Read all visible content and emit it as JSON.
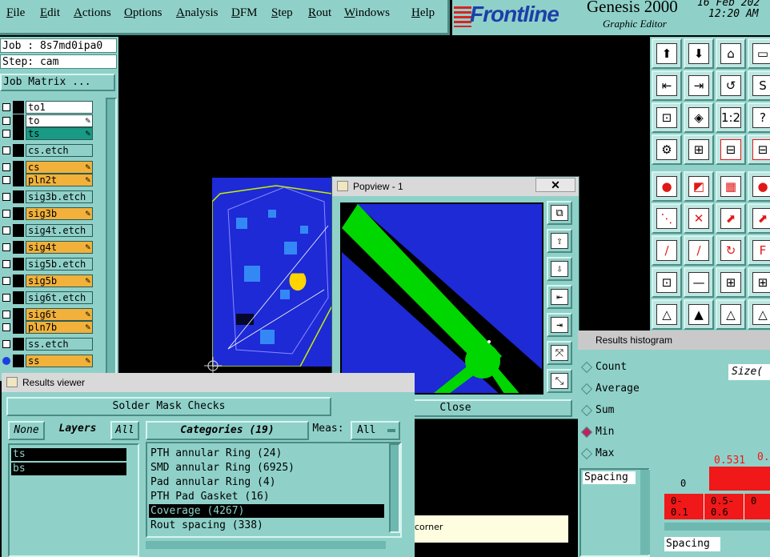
{
  "menu": {
    "items": [
      {
        "label": "File",
        "u": "F",
        "rest": "ile"
      },
      {
        "label": "Edit",
        "u": "E",
        "rest": "dit"
      },
      {
        "label": "Actions",
        "u": "A",
        "rest": "ctions"
      },
      {
        "label": "Options",
        "u": "O",
        "rest": "ptions"
      },
      {
        "label": "Analysis",
        "u": "A",
        "rest": "nalysis"
      },
      {
        "label": "DFM",
        "u": "D",
        "rest": "FM"
      },
      {
        "label": "Step",
        "u": "S",
        "rest": "tep"
      },
      {
        "label": "Rout",
        "u": "R",
        "rest": "out"
      },
      {
        "label": "Windows",
        "u": "W",
        "rest": "indows"
      },
      {
        "label": "Help",
        "u": "H",
        "rest": "elp"
      }
    ]
  },
  "brand": {
    "logo": "Frontline",
    "product": "Genesis 2000",
    "subtitle": "Graphic Editor",
    "date": "16 Feb 202",
    "time": "12:20 AM"
  },
  "job": {
    "job_line": "Job : 8s7md0ipa0",
    "step_line": "Step: cam",
    "matrix_button": "Job Matrix ..."
  },
  "layers": [
    {
      "name": "to1",
      "bg": "#ffffff",
      "pen": false
    },
    {
      "name": "to",
      "bg": "#ffffff",
      "pen": true
    },
    {
      "name": "ts",
      "bg": "#199a85",
      "pen": true
    },
    {
      "name": "cs.etch",
      "bg": "#8fd1c9",
      "pen": false
    },
    {
      "name": "cs",
      "bg": "#f2b13a",
      "pen": true
    },
    {
      "name": "pln2t",
      "bg": "#f2b13a",
      "pen": true
    },
    {
      "name": "sig3b.etch",
      "bg": "#8fd1c9",
      "pen": false
    },
    {
      "name": "sig3b",
      "bg": "#f2b13a",
      "pen": true
    },
    {
      "name": "sig4t.etch",
      "bg": "#8fd1c9",
      "pen": false
    },
    {
      "name": "sig4t",
      "bg": "#f2b13a",
      "pen": true
    },
    {
      "name": "sig5b.etch",
      "bg": "#8fd1c9",
      "pen": false
    },
    {
      "name": "sig5b",
      "bg": "#f2b13a",
      "pen": true
    },
    {
      "name": "sig6t.etch",
      "bg": "#8fd1c9",
      "pen": false
    },
    {
      "name": "sig6t",
      "bg": "#f2b13a",
      "pen": true
    },
    {
      "name": "pln7b",
      "bg": "#f2b13a",
      "pen": true
    },
    {
      "name": "ss.etch",
      "bg": "#8fd1c9",
      "pen": false
    },
    {
      "name": "ss",
      "bg": "#f2b13a",
      "pen": true
    }
  ],
  "popview": {
    "title": "Popview - 1",
    "close_x": "✕",
    "close_button": "Close"
  },
  "histogram": {
    "title": "Results histogram",
    "options": [
      {
        "label": "Count",
        "on": false
      },
      {
        "label": "Average",
        "on": false
      },
      {
        "label": "Sum",
        "on": false
      },
      {
        "label": "Min",
        "on": true
      },
      {
        "label": "Max",
        "on": false
      }
    ],
    "list_item": "Spacing",
    "list_item_2": "Spacing",
    "size_label": "Size(",
    "bar_value_1": "0.531",
    "bar_value_2": "0.",
    "axis_zero": "0",
    "bins": [
      "0-\n0.1",
      "0.5-\n0.6",
      "0"
    ]
  },
  "results_viewer": {
    "title": "Results viewer",
    "check_name": "Solder Mask Checks",
    "none_btn": "None",
    "layers_label": "Layers",
    "all_btn": "All",
    "categories_label": "Categories (19)",
    "meas_label": "Meas:",
    "meas_value": "All",
    "layers": [
      "ts",
      "bs"
    ],
    "categories": [
      {
        "label": "PTH annular Ring (24)",
        "sel": false
      },
      {
        "label": "SMD annular Ring (6925)",
        "sel": false
      },
      {
        "label": "Pad annular Ring (4)",
        "sel": false
      },
      {
        "label": "PTH Pad Gasket (16)",
        "sel": false
      },
      {
        "label": "Coverage (4267)",
        "sel": true
      },
      {
        "label": "Rout spacing (338)",
        "sel": false
      }
    ]
  },
  "corner_text": "corner",
  "colors": {
    "panel": "#8fd1c9",
    "board_blue": "#1e2ad6",
    "copper_green": "#00d600",
    "highlight_red": "#f01818",
    "orange": "#f2b13a"
  }
}
